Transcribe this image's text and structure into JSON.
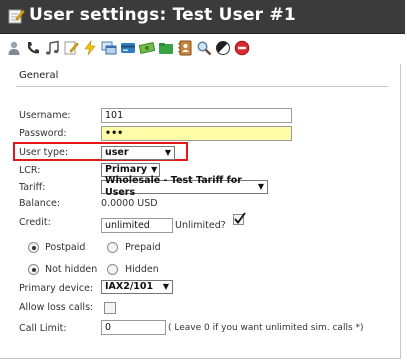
{
  "window": {
    "title": "User settings: Test User #1"
  },
  "toolbar": {
    "icons": [
      "user-icon",
      "phone-icon",
      "music-note-icon",
      "edit-icon",
      "lightning-icon",
      "windows-icon",
      "cards-icon",
      "money-icon",
      "folder-icon",
      "contacts-book-icon",
      "search-icon",
      "half-circle-icon",
      "delete-icon"
    ]
  },
  "section": {
    "title": "General"
  },
  "form": {
    "username_label": "Username:",
    "username_value": "101",
    "password_label": "Password:",
    "password_value": "•••",
    "user_type_label": "User type:",
    "user_type_value": "user",
    "lcr_label": "LCR:",
    "lcr_value": "Primary",
    "tariff_label": "Tariff:",
    "tariff_value": "Wholesale - Test Tariff for Users",
    "balance_label": "Balance:",
    "balance_value": "0.0000 USD",
    "credit_label": "Credit:",
    "credit_value": "unlimited",
    "unlimited_label": "Unlimited?",
    "unlimited_checked": true,
    "postpaid_label": "Postpaid",
    "prepaid_label": "Prepaid",
    "payment_selected": "Postpaid",
    "not_hidden_label": "Not hidden",
    "hidden_label": "Hidden",
    "visibility_selected": "Not hidden",
    "primary_device_label": "Primary device:",
    "primary_device_value": "IAX2/101",
    "allow_loss_calls_label": "Allow loss calls:",
    "allow_loss_calls_checked": false,
    "call_limit_label": "Call Limit:",
    "call_limit_value": "0",
    "call_limit_note": "( Leave 0 if you want unlimited sim. calls *)"
  },
  "colors": {
    "title_bar": "#3b3b3b",
    "highlight_border": "#e5171b",
    "password_field_bg": "#fffda8"
  }
}
